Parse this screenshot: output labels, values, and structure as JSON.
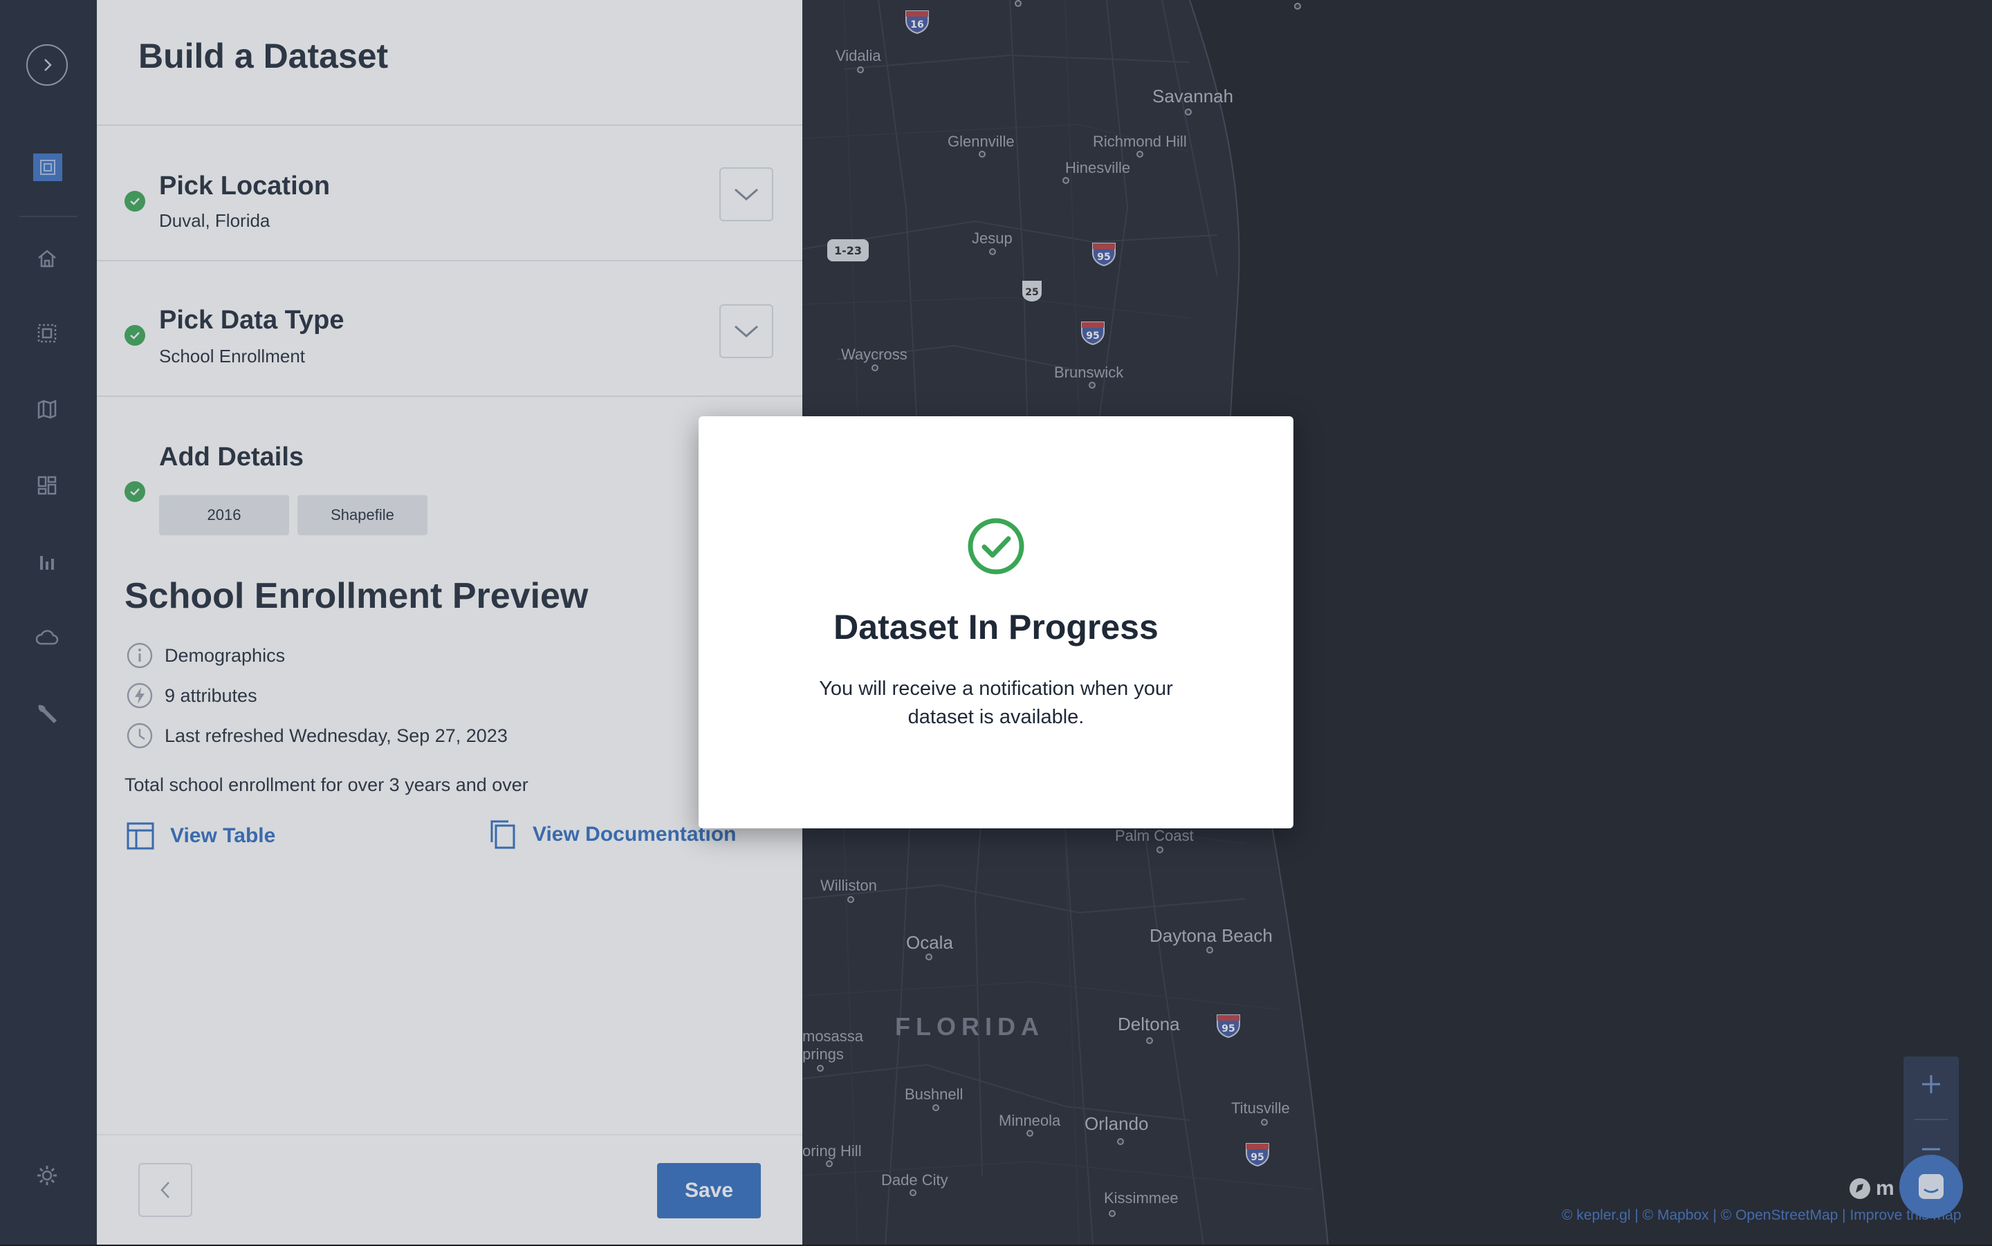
{
  "builder": {
    "title": "Build a Dataset",
    "steps": [
      {
        "title": "Pick Location",
        "value": "Duval, Florida"
      },
      {
        "title": "Pick Data Type",
        "value": "School Enrollment"
      },
      {
        "title": "Add Details",
        "chips": [
          "2016",
          "Shapefile"
        ]
      }
    ],
    "preview": {
      "title": "School Enrollment Preview",
      "category": "Demographics",
      "attributes": "9 attributes",
      "refreshed": "Last refreshed Wednesday, Sep 27, 2023",
      "description": "Total school enrollment for over 3 years and over",
      "view_table": "View Table",
      "view_docs": "View Documentation"
    },
    "save_label": "Save"
  },
  "map": {
    "places": {
      "vidalia": "Vidalia",
      "savannah": "Savannah",
      "glennville": "Glennville",
      "richmond_hill": "Richmond Hill",
      "hinesville": "Hinesville",
      "jesup": "Jesup",
      "waycross": "Waycross",
      "brunswick": "Brunswick",
      "palm_coast": "Palm Coast",
      "williston": "Williston",
      "ocala": "Ocala",
      "daytona_beach": "Daytona Beach",
      "florida": "FLORIDA",
      "deltona": "Deltona",
      "homosassa": "mosassa",
      "springs": "prings",
      "bushnell": "Bushnell",
      "minneola": "Minneola",
      "orlando": "Orlando",
      "titusville": "Titusville",
      "spring_hill": "oring Hill",
      "dade_city": "Dade City",
      "kissimmee": "Kissimmee"
    },
    "shields": {
      "i16": "16",
      "i23": "1-23",
      "us25": "25",
      "i95": "95"
    },
    "mapbox_text": "m",
    "attribution": "© kepler.gl | © Mapbox | © OpenStreetMap | Improve this map"
  },
  "modal": {
    "title": "Dataset In Progress",
    "message": "You will receive a notification when your dataset is available."
  },
  "colors": {
    "accent": "#2f6cc0",
    "success": "#3aa655",
    "rail": "#1d2535",
    "map_bg": "#1b1f2a"
  }
}
